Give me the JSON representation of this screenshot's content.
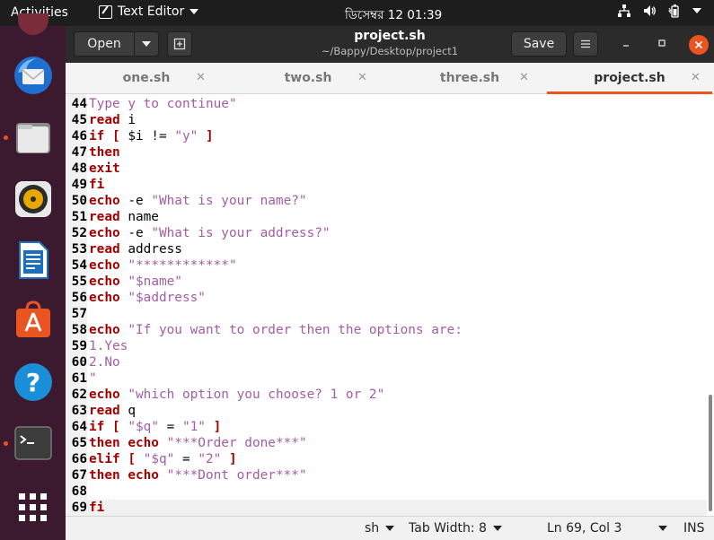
{
  "topbar": {
    "activities": "Activities",
    "app_name": "Text Editor",
    "clock": "ডিসেম্বর 12  01:39"
  },
  "headerbar": {
    "open_label": "Open",
    "title": "project.sh",
    "subtitle": "~/Bappy/Desktop/project1",
    "save_label": "Save"
  },
  "tabs": [
    {
      "label": "one.sh"
    },
    {
      "label": "two.sh"
    },
    {
      "label": "three.sh"
    },
    {
      "label": "project.sh"
    }
  ],
  "editor": {
    "current_line": 69,
    "lines": [
      {
        "n": "44",
        "t": [
          {
            "c": "st",
            "s": "Type y to continue\""
          }
        ]
      },
      {
        "n": "45",
        "t": [
          {
            "c": "kw",
            "s": "read"
          },
          {
            "c": "",
            "s": " i"
          }
        ]
      },
      {
        "n": "46",
        "t": [
          {
            "c": "kw",
            "s": "if ["
          },
          {
            "c": "",
            "s": " $i != "
          },
          {
            "c": "st",
            "s": "\"y\""
          },
          {
            "c": "",
            "s": " "
          },
          {
            "c": "kw",
            "s": "]"
          }
        ]
      },
      {
        "n": "47",
        "t": [
          {
            "c": "kw",
            "s": "then"
          }
        ]
      },
      {
        "n": "48",
        "t": [
          {
            "c": "kw",
            "s": "exit"
          }
        ]
      },
      {
        "n": "49",
        "t": [
          {
            "c": "kw",
            "s": "fi"
          }
        ]
      },
      {
        "n": "50",
        "t": [
          {
            "c": "kw",
            "s": "echo"
          },
          {
            "c": "",
            "s": " -e "
          },
          {
            "c": "st",
            "s": "\"What is your name?\""
          }
        ]
      },
      {
        "n": "51",
        "t": [
          {
            "c": "kw",
            "s": "read"
          },
          {
            "c": "",
            "s": " name"
          }
        ]
      },
      {
        "n": "52",
        "t": [
          {
            "c": "kw",
            "s": "echo"
          },
          {
            "c": "",
            "s": " -e "
          },
          {
            "c": "st",
            "s": "\"What is your address?\""
          }
        ]
      },
      {
        "n": "53",
        "t": [
          {
            "c": "kw",
            "s": "read"
          },
          {
            "c": "",
            "s": " address"
          }
        ]
      },
      {
        "n": "54",
        "t": [
          {
            "c": "kw",
            "s": "echo"
          },
          {
            "c": "",
            "s": " "
          },
          {
            "c": "st",
            "s": "\"************\""
          }
        ]
      },
      {
        "n": "55",
        "t": [
          {
            "c": "kw",
            "s": "echo"
          },
          {
            "c": "",
            "s": " "
          },
          {
            "c": "st",
            "s": "\"$name\""
          }
        ]
      },
      {
        "n": "56",
        "t": [
          {
            "c": "kw",
            "s": "echo"
          },
          {
            "c": "",
            "s": " "
          },
          {
            "c": "st",
            "s": "\"$address\""
          }
        ]
      },
      {
        "n": "57",
        "t": []
      },
      {
        "n": "58",
        "t": [
          {
            "c": "kw",
            "s": "echo"
          },
          {
            "c": "",
            "s": " "
          },
          {
            "c": "st",
            "s": "\"If you want to order then the options are:"
          }
        ]
      },
      {
        "n": "59",
        "t": [
          {
            "c": "st",
            "s": "1.Yes"
          }
        ]
      },
      {
        "n": "60",
        "t": [
          {
            "c": "st",
            "s": "2.No"
          }
        ]
      },
      {
        "n": "61",
        "t": [
          {
            "c": "st",
            "s": "\""
          }
        ]
      },
      {
        "n": "62",
        "t": [
          {
            "c": "kw",
            "s": "echo"
          },
          {
            "c": "",
            "s": " "
          },
          {
            "c": "st",
            "s": "\"which option you choose? 1 or 2\""
          }
        ]
      },
      {
        "n": "63",
        "t": [
          {
            "c": "kw",
            "s": "read"
          },
          {
            "c": "",
            "s": " q"
          }
        ]
      },
      {
        "n": "64",
        "t": [
          {
            "c": "kw",
            "s": "if ["
          },
          {
            "c": "",
            "s": " "
          },
          {
            "c": "st",
            "s": "\"$q\""
          },
          {
            "c": "",
            "s": " = "
          },
          {
            "c": "st",
            "s": "\"1\""
          },
          {
            "c": "",
            "s": " "
          },
          {
            "c": "kw",
            "s": "]"
          }
        ]
      },
      {
        "n": "65",
        "t": [
          {
            "c": "kw",
            "s": "then echo"
          },
          {
            "c": "",
            "s": " "
          },
          {
            "c": "st",
            "s": "\"***Order done***\""
          }
        ]
      },
      {
        "n": "66",
        "t": [
          {
            "c": "kw",
            "s": "elif ["
          },
          {
            "c": "",
            "s": " "
          },
          {
            "c": "st",
            "s": "\"$q\""
          },
          {
            "c": "",
            "s": " = "
          },
          {
            "c": "st",
            "s": "\"2\""
          },
          {
            "c": "",
            "s": " "
          },
          {
            "c": "kw",
            "s": "]"
          }
        ]
      },
      {
        "n": "67",
        "t": [
          {
            "c": "kw",
            "s": "then echo"
          },
          {
            "c": "",
            "s": " "
          },
          {
            "c": "st",
            "s": "\"***Dont order***\""
          }
        ]
      },
      {
        "n": "68",
        "t": []
      },
      {
        "n": "69",
        "t": [
          {
            "c": "kw",
            "s": "fi"
          }
        ]
      }
    ]
  },
  "statusbar": {
    "language": "sh",
    "tab_width": "Tab Width: 8",
    "position": "Ln 69, Col 3",
    "mode": "INS"
  },
  "dock": [
    {
      "icon": "thunderbird-icon"
    },
    {
      "icon": "files-icon"
    },
    {
      "icon": "rhythmbox-icon"
    },
    {
      "icon": "libreoffice-writer-icon"
    },
    {
      "icon": "ubuntu-software-icon"
    },
    {
      "icon": "help-icon"
    },
    {
      "icon": "terminal-icon"
    },
    {
      "icon": "show-applications-icon"
    }
  ],
  "colors": {
    "accent": "#e95420",
    "keyword": "#a40000",
    "string": "#a35da3",
    "dock_bg": "#3b1a30"
  }
}
